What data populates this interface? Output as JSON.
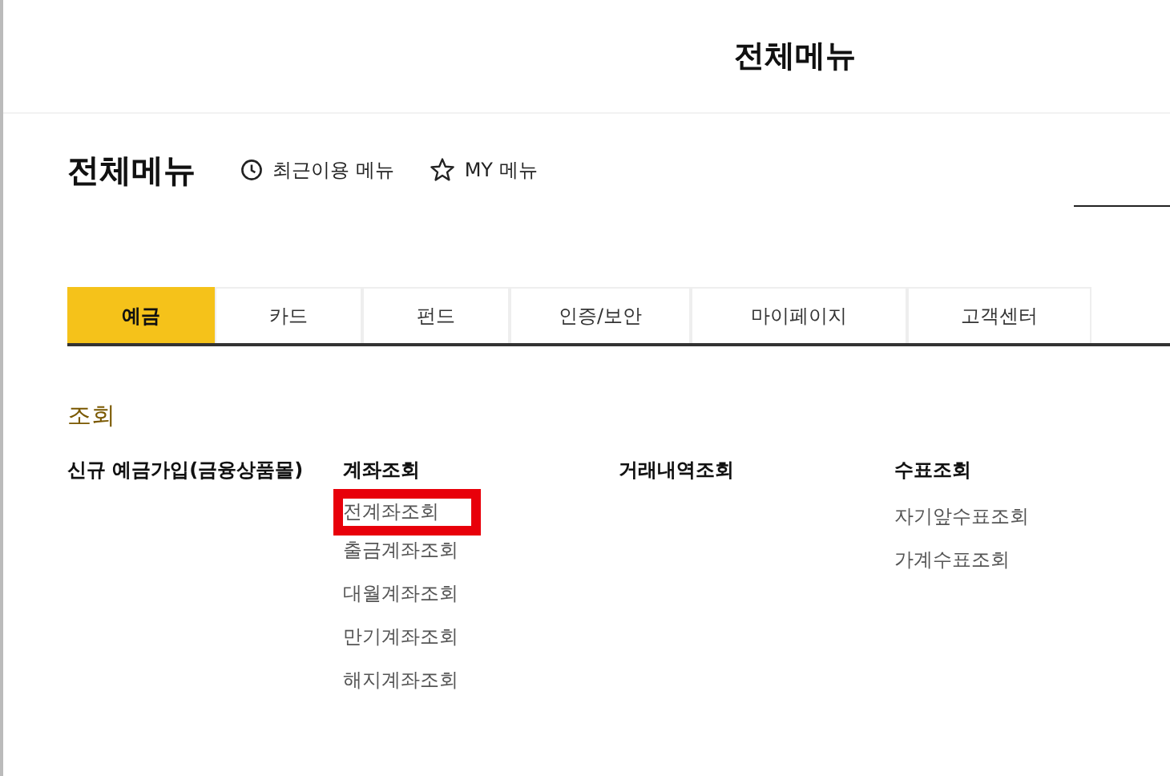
{
  "header": {
    "title": "전체메뉴"
  },
  "menu_bar": {
    "title": "전체메뉴",
    "links": [
      {
        "kind": "recent",
        "label": "최근이용 메뉴"
      },
      {
        "kind": "my",
        "label": "MY 메뉴"
      }
    ]
  },
  "tabs": [
    {
      "label": "예금",
      "selected": true
    },
    {
      "label": "카드",
      "selected": false
    },
    {
      "label": "펀드",
      "selected": false
    },
    {
      "label": "인증/보안",
      "selected": false
    },
    {
      "label": "마이페이지",
      "selected": false
    },
    {
      "label": "고객센터",
      "selected": false
    }
  ],
  "section": {
    "title": "조회",
    "columns": [
      {
        "heading": "신규 예금가입(금융상품몰)"
      },
      {
        "heading": "계좌조회",
        "items": [
          {
            "label": "전계좌조회",
            "highlighted": true
          },
          {
            "label": "출금계좌조회",
            "highlighted": false
          },
          {
            "label": "대월계좌조회",
            "highlighted": false
          },
          {
            "label": "만기계좌조회",
            "highlighted": false
          },
          {
            "label": "해지계좌조회",
            "highlighted": false
          }
        ]
      },
      {
        "heading": "거래내역조회"
      },
      {
        "heading": "수표조회",
        "items": [
          {
            "label": "자기앞수표조회",
            "highlighted": false
          },
          {
            "label": "가계수표조회",
            "highlighted": false
          }
        ]
      }
    ]
  }
}
